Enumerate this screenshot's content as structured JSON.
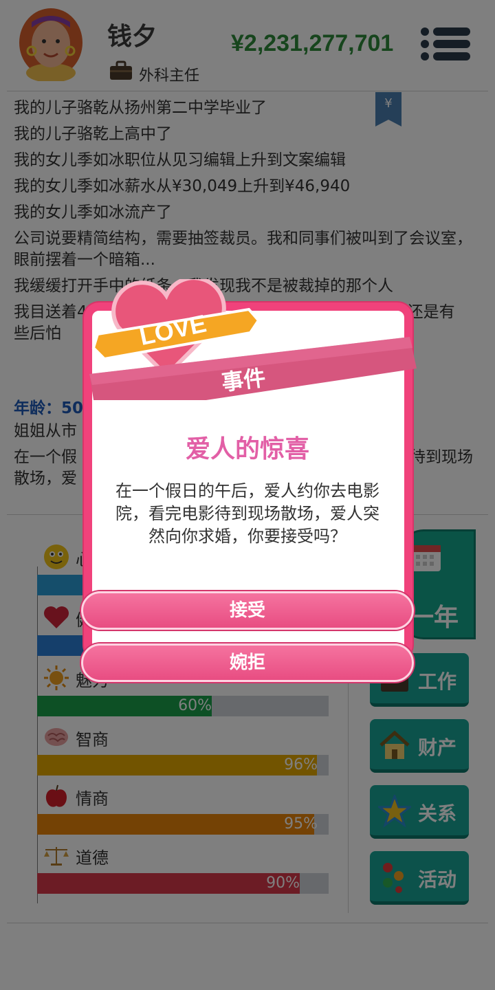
{
  "player": {
    "name": "钱夕",
    "job": "外科主任",
    "money": "¥2,231,277,701"
  },
  "log": [
    "我的儿子骆乾从扬州第二中学毕业了",
    "我的儿子骆乾上高中了",
    "我的女儿季如冰职位从见习编辑上升到文案编辑",
    "我的女儿季如冰薪水从¥30,049上升到¥46,940",
    "我的女儿季如冰流产了",
    "公司说要精简结构，需要抽签裁员。我和同事们被叫到了会议室，眼前摆着一个暗箱...",
    "我缓缓打开手中的纸条，我发现我不是被裁掉的那个人",
    "我目送着4",
    "但我还是有",
    "些后怕"
  ],
  "age_label": "年龄：50",
  "log2": [
    "姐姐从市",
    "在一个假",
    "待到现场",
    "散场，爱"
  ],
  "stats": [
    {
      "label": "心",
      "percent": null,
      "color": "#2a9dd6"
    },
    {
      "label": "健",
      "percent": null,
      "color": "#2a7fd6"
    },
    {
      "label": "魅力",
      "percent": "60%",
      "value": 60,
      "color": "#1aa14a"
    },
    {
      "label": "智商",
      "percent": "96%",
      "value": 96,
      "color": "#e5a800"
    },
    {
      "label": "情商",
      "percent": "95%",
      "value": 95,
      "color": "#e8840a"
    },
    {
      "label": "道德",
      "percent": "90%",
      "value": 90,
      "color": "#d8394a"
    }
  ],
  "actions": {
    "year_label": "一年",
    "work": "工作",
    "property": "财产",
    "relations": "关系",
    "activities": "活动"
  },
  "dialog": {
    "ribbon": "事件",
    "love_badge": "LOVE",
    "title": "爱人的惊喜",
    "body": "在一个假日的午后，爱人约你去电影院，看完电影待到现场散场，爱人突然向你求婚，你要接受吗？",
    "accept": "接受",
    "decline": "婉拒"
  },
  "colors": {
    "money": "#2e8b3a",
    "accent_pink": "#f0427b",
    "teal": "#19a596"
  }
}
